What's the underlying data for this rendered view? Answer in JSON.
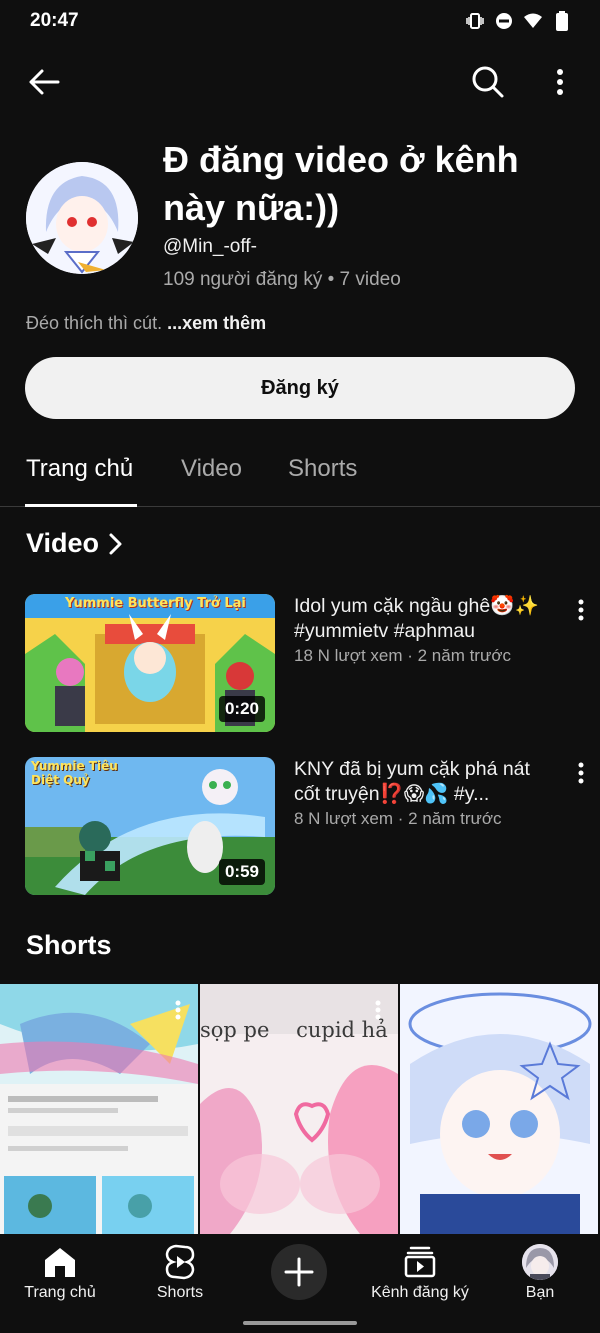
{
  "status_bar": {
    "time": "20:47"
  },
  "channel": {
    "title": "Đ đăng video ở kênh này nữa:))",
    "handle": "@Min_-off-",
    "stats": "109 người đăng ký • 7 video",
    "description": "Đéo thích thì cút.",
    "more_label": "...xem thêm",
    "subscribe_label": "Đăng ký"
  },
  "tabs": [
    {
      "label": "Trang chủ",
      "active": true
    },
    {
      "label": "Video",
      "active": false
    },
    {
      "label": "Shorts",
      "active": false
    }
  ],
  "sections": {
    "videos_title": "Video",
    "shorts_title": "Shorts"
  },
  "videos": [
    {
      "thumb_text": "Yummie Butterfly Trở Lại",
      "duration": "0:20",
      "title": "Idol yum cặk ngầu ghê🤡✨ #yummietv #aphmau",
      "meta": "18 N lượt xem · 2 năm trước"
    },
    {
      "thumb_text": "Yummie Tiêu Diệt Quỷ",
      "duration": "0:59",
      "title": "KNY đã bị yum cặk phá nát cốt truyện⁉️😱💦 #y...",
      "meta": "8 N lượt xem · 2 năm trước"
    }
  ],
  "shorts": [
    {
      "overlay_text": ""
    },
    {
      "overlay_text": "sọp pe    cupid hả"
    },
    {
      "overlay_text": ""
    }
  ],
  "bottom_nav": {
    "home": "Trang chủ",
    "shorts": "Shorts",
    "subscriptions": "Kênh đăng ký",
    "you": "Bạn"
  },
  "colors": {
    "background": "#0f0f0f",
    "text_primary": "#f1f1f1",
    "text_secondary": "#aaaaaa",
    "button_light": "#f1f1f1"
  }
}
